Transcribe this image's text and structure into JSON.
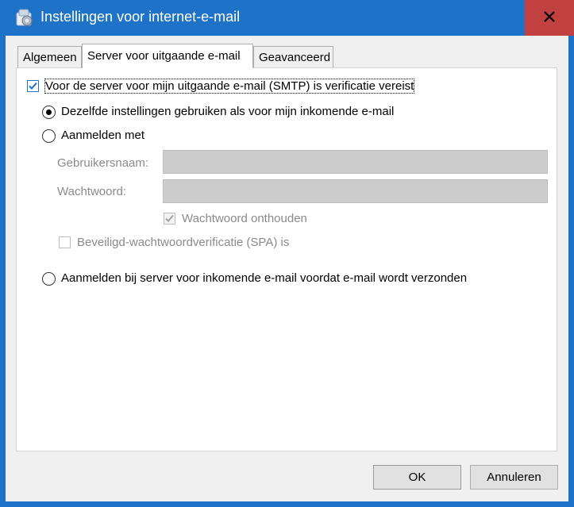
{
  "window": {
    "title": "Instellingen voor internet-e-mail",
    "app_icon": "outlook-settings-icon",
    "close_icon": "close-icon"
  },
  "tabs": [
    {
      "label": "Algemeen",
      "active": false
    },
    {
      "label": "Server voor uitgaande e-mail",
      "active": true
    },
    {
      "label": "Geavanceerd",
      "active": false
    }
  ],
  "auth_required": {
    "label": "Voor de server voor mijn uitgaande e-mail (SMTP) is verificatie vereist",
    "checked": true
  },
  "options": {
    "same_settings": {
      "label": "Dezelfde instellingen gebruiken als voor mijn inkomende e-mail",
      "selected": true
    },
    "log_on_with": {
      "label": "Aanmelden met",
      "selected": false
    },
    "username": {
      "label": "Gebruikersnaam:",
      "value": ""
    },
    "password": {
      "label": "Wachtwoord:",
      "value": ""
    },
    "remember_password": {
      "label": "Wachtwoord onthouden",
      "checked": true,
      "disabled": true
    },
    "spa": {
      "label": "Beveiligd-wachtwoordverificatie (SPA) is",
      "checked": false,
      "disabled": true
    },
    "log_on_incoming_first": {
      "label": "Aanmelden bij server voor inkomende e-mail voordat e-mail wordt verzonden",
      "selected": false
    }
  },
  "buttons": {
    "ok": "OK",
    "cancel": "Annuleren"
  },
  "colors": {
    "titlebar": "#1e72c8",
    "close_hover": "#c14040",
    "checkbox_accent": "#1e72c8"
  }
}
